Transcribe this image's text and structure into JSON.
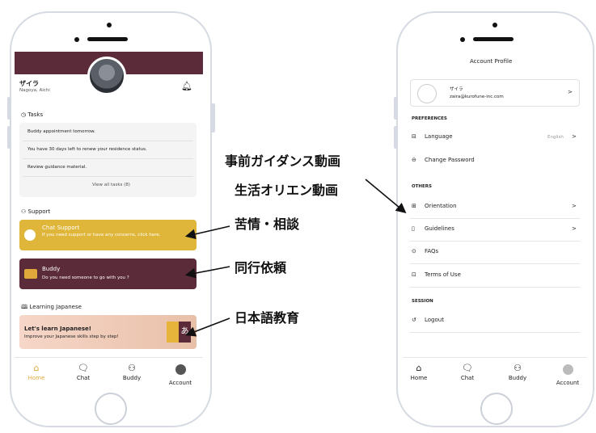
{
  "left": {
    "user": {
      "name": "ザイラ",
      "location": "Nagoya, Aichi"
    },
    "tasks": {
      "heading": "Tasks",
      "items": [
        "Buddy appointment tomorrow.",
        "You have 30 days left to renew your residence status.",
        "Review guidance material."
      ],
      "view_all": "View all tasks (8)"
    },
    "support": {
      "heading": "Support",
      "chat_title": "Chat Support",
      "chat_desc": "If you need support or have any concerns, click here.",
      "buddy_title": "Buddy",
      "buddy_desc": "Do you need someone to go with you ?"
    },
    "learning": {
      "heading": "Learning Japanese",
      "title": "Let's learn Japanese!",
      "desc": "Improve your Japanese skills step by step!",
      "badge": "あ"
    },
    "tabs": [
      "Home",
      "Chat",
      "Buddy",
      "Account"
    ]
  },
  "right": {
    "title": "Account Profile",
    "profile": {
      "name": "ザイラ",
      "email": "zaira@kurofune-inc.com"
    },
    "preferences": {
      "heading": "PREFERENCES",
      "language_label": "Language",
      "language_value": "English",
      "change_password": "Change Password"
    },
    "others": {
      "heading": "OTHERS",
      "orientation": "Orientation",
      "guidelines": "Guidelines",
      "faqs": "FAQs",
      "terms": "Terms of Use"
    },
    "session": {
      "heading": "SESSION",
      "logout": "Logout"
    },
    "tabs": [
      "Home",
      "Chat",
      "Buddy",
      "Account"
    ]
  },
  "annotations": [
    "事前ガイダンス動画",
    "生活オリエン動画",
    "苦情・相談",
    "同行依頼",
    "日本語教育"
  ],
  "colors": {
    "maroon": "#5b2b39",
    "gold": "#dfb63a",
    "active_tab": "#e0a83a"
  },
  "icons": [
    "bell-icon",
    "clock-icon",
    "people-icon",
    "book-icon",
    "chat-bubble-icon",
    "home-icon",
    "chevron-right-icon",
    "language-icon",
    "lock-icon",
    "document-icon",
    "help-icon",
    "logout-icon"
  ]
}
